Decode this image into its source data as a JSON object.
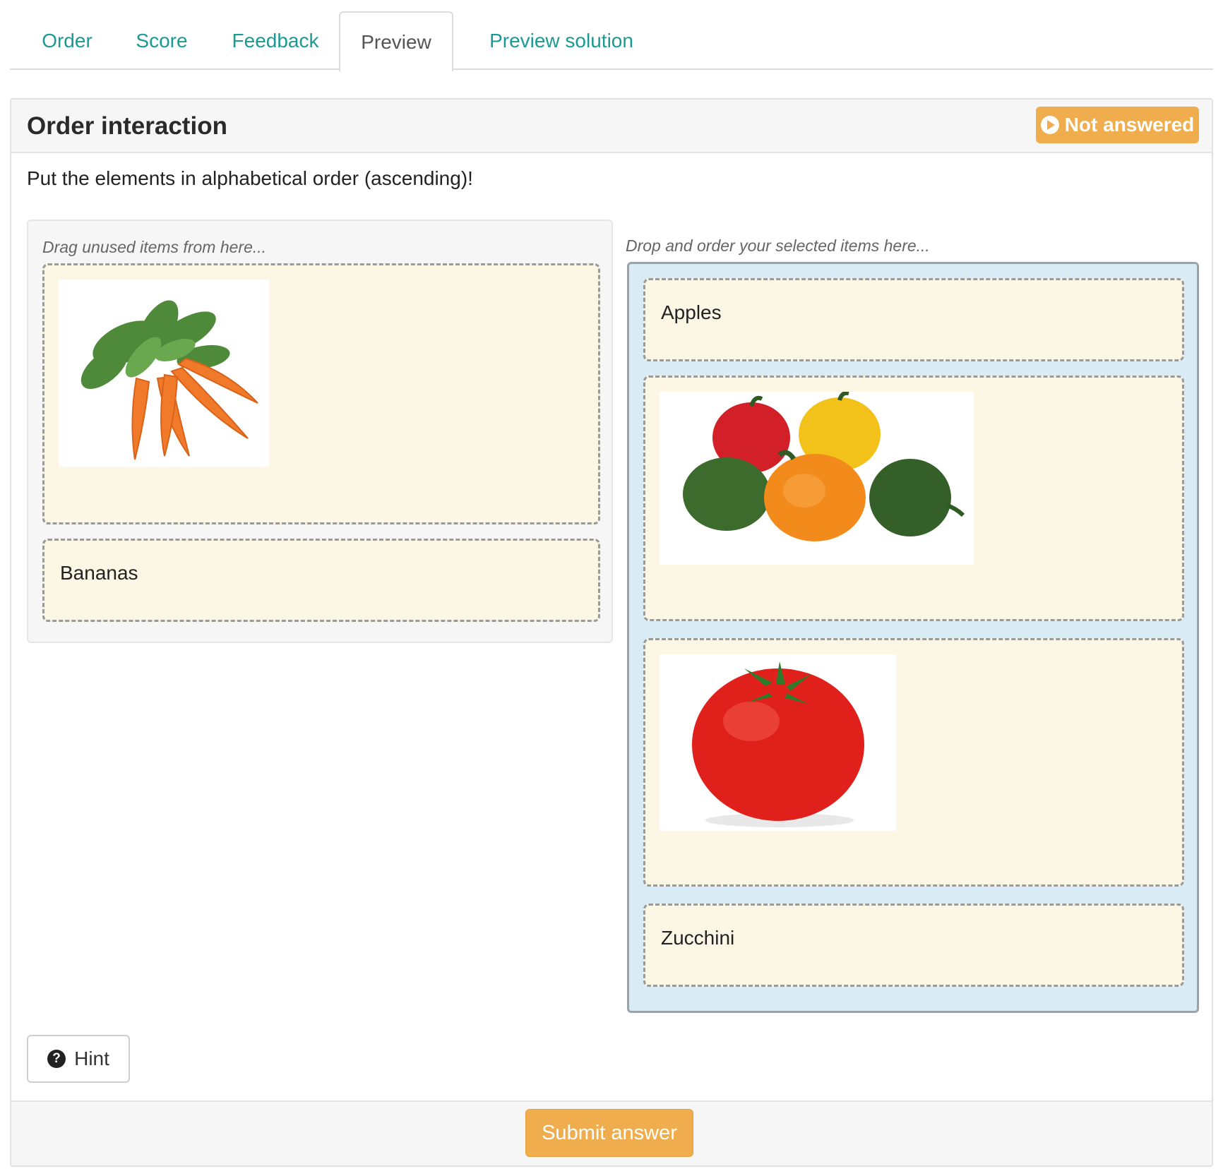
{
  "tabs": [
    {
      "label": "Order",
      "active": false
    },
    {
      "label": "Score",
      "active": false
    },
    {
      "label": "Feedback",
      "active": false
    },
    {
      "label": "Preview",
      "active": true
    },
    {
      "label": "Preview solution",
      "active": false
    }
  ],
  "panel": {
    "title": "Order interaction",
    "status_badge": "Not answered",
    "status_icon": "play-circle-icon",
    "instruction": "Put the elements in alphabetical order (ascending)!"
  },
  "source": {
    "hint": "Drag unused items from here...",
    "items": [
      {
        "type": "image",
        "image": "carrots"
      },
      {
        "type": "text",
        "label": "Bananas"
      }
    ]
  },
  "target": {
    "hint": "Drop and order your selected items here...",
    "items": [
      {
        "type": "text",
        "label": "Apples"
      },
      {
        "type": "image",
        "image": "bell-peppers"
      },
      {
        "type": "image",
        "image": "tomato"
      },
      {
        "type": "text",
        "label": "Zucchini"
      }
    ]
  },
  "buttons": {
    "hint": "Hint",
    "hint_icon": "question-circle-icon",
    "submit": "Submit answer"
  },
  "colors": {
    "accent": "#1a9a93",
    "warning": "#f0ad4e",
    "card_bg": "#fcf7e4",
    "dropzone_bg": "#d9ebf4"
  }
}
